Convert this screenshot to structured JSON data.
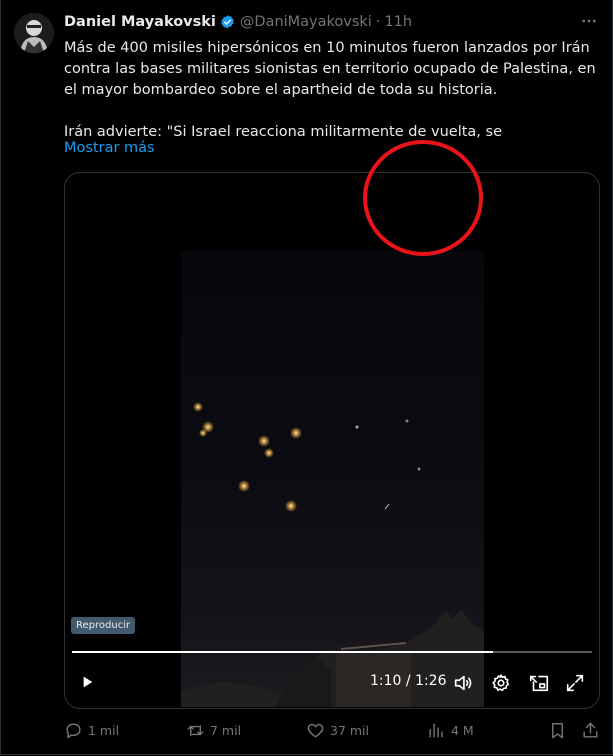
{
  "author": {
    "name": "Daniel Mayakovski",
    "handle": "@DaniMayakovski",
    "separator": "·",
    "time": "11h"
  },
  "tweet": {
    "paragraph1": "Más de 400 misiles hipersónicos en 10 minutos fueron lanzados por Irán contra las bases militares sionistas en territorio ocupado de Palestina, en el mayor bombardeo sobre el apartheid de toda su historia.",
    "paragraph2": "Irán advierte: \"Si Israel reacciona militarmente de vuelta, se",
    "show_more": "Mostrar más"
  },
  "video": {
    "badge": "Reproducir",
    "current_time": "1:10",
    "duration": "1:26",
    "time_display": "1:10 / 1:26",
    "progress_fraction": 0.81
  },
  "actions": {
    "replies": "1 mil",
    "reposts": "7 mil",
    "likes": "37 mil",
    "views": "4 M"
  },
  "colors": {
    "accent": "#1d9bf0",
    "muted": "#71767b",
    "annotation": "#e8141a"
  },
  "icons": [
    "verified-badge-icon",
    "more-icon",
    "play-icon",
    "volume-icon",
    "settings-icon",
    "pip-icon",
    "fullscreen-icon",
    "reply-icon",
    "repost-icon",
    "like-icon",
    "views-icon",
    "bookmark-icon",
    "share-icon"
  ]
}
